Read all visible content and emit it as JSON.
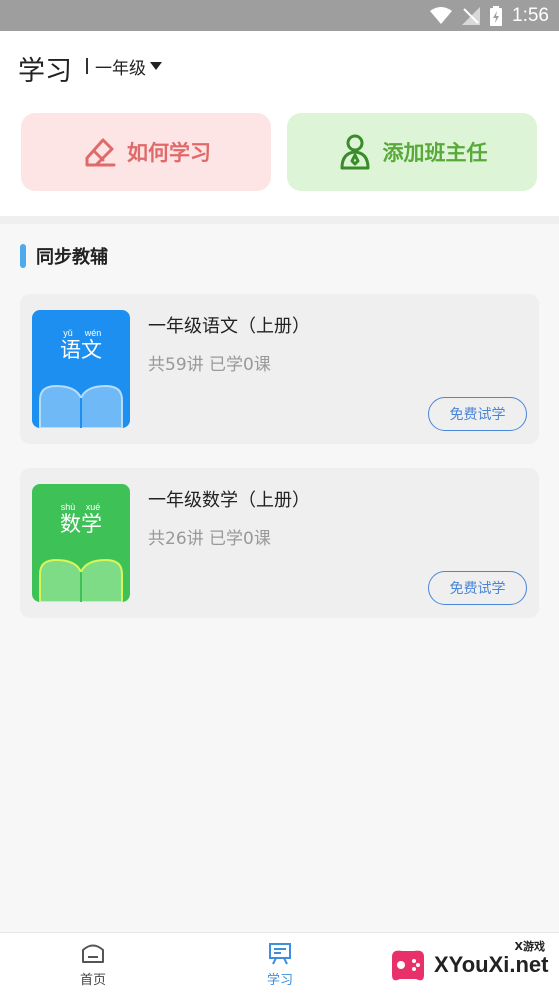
{
  "status_bar": {
    "time": "1:56",
    "icons": [
      "wifi-icon",
      "signal-icon",
      "battery-icon"
    ]
  },
  "header": {
    "title": "学习",
    "grade": "一年级"
  },
  "actions": [
    {
      "label": "如何学习",
      "icon": "pencil-eraser-icon",
      "color": "#e06a6a"
    },
    {
      "label": "添加班主任",
      "icon": "person-icon",
      "color": "#58a93a"
    }
  ],
  "section": {
    "title": "同步教辅"
  },
  "courses": [
    {
      "title": "一年级语文（上册）",
      "meta": "共59讲 已学0课",
      "cover_pinyin": [
        "yǔ",
        "wén"
      ],
      "cover_text": "语文",
      "cover_color": "#1d8ff0",
      "button": "免费试学"
    },
    {
      "title": "一年级数学（上册）",
      "meta": "共26讲 已学0课",
      "cover_pinyin": [
        "shù",
        "xué"
      ],
      "cover_text": "数学",
      "cover_color": "#3ec258",
      "button": "免费试学"
    }
  ],
  "bottom_nav": [
    {
      "label": "首页",
      "icon": "home-icon",
      "active": false
    },
    {
      "label": "学习",
      "icon": "study-board-icon",
      "active": true
    }
  ],
  "watermark": {
    "text": "XYouXi.net",
    "small": "X游戏"
  }
}
